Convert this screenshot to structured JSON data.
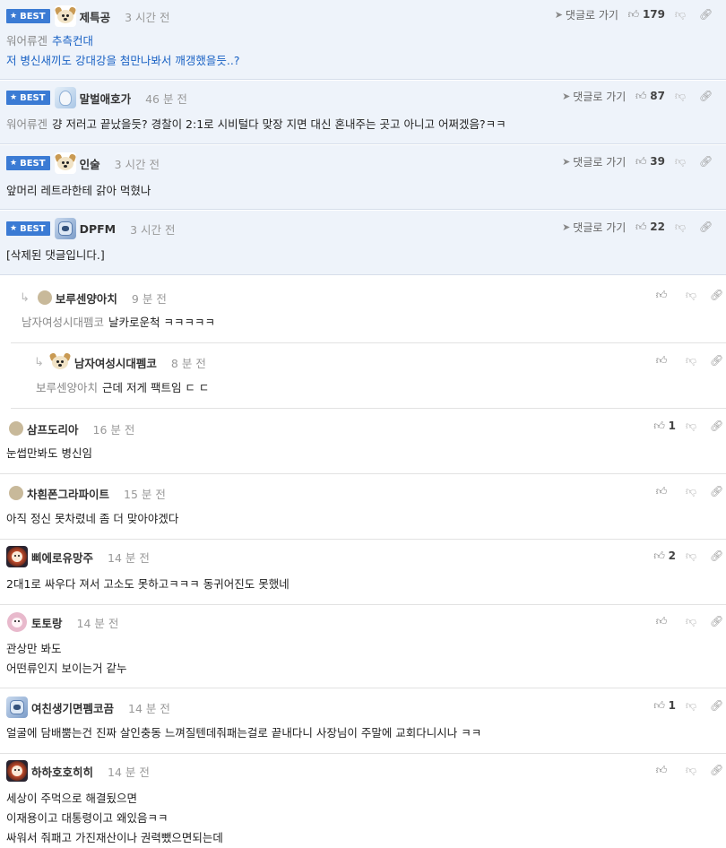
{
  "ui": {
    "best_label": "BEST",
    "reply_label": "댓글로 가기",
    "reply_arrow": "↳"
  },
  "comments": [
    {
      "best": true,
      "nick": "제특공",
      "time": "3 시간 전",
      "likes": "179",
      "avatar": "dog",
      "mention": "워어류겐",
      "lines": [
        "추측컨대",
        "저 병신새끼도 강대강을 첨만나봐서 깨갱했을듯..?"
      ],
      "link_color": true
    },
    {
      "best": true,
      "nick": "말벌애호가",
      "time": "46 분 전",
      "likes": "87",
      "avatar": "dolphin",
      "mention": "워어류겐",
      "lines": [
        "걍 저러고 끝났을듯? 경찰이 2:1로 시비털다 맞장 지면 대신 혼내주는 곳고 아니고 어쩌겠음?ㅋㅋ"
      ]
    },
    {
      "best": true,
      "nick": "인술",
      "time": "3 시간 전",
      "likes": "39",
      "avatar": "dog",
      "mention": "",
      "lines": [
        "앞머리 레트라한테 갉아 먹혔나"
      ]
    },
    {
      "best": true,
      "nick": "DPFM",
      "time": "3 시간 전",
      "likes": "22",
      "avatar": "blob",
      "mention": "",
      "lines": [
        "[삭제된 댓글입니다.]"
      ]
    },
    {
      "best": false,
      "nick": "보루센양아치",
      "time": "9 분 전",
      "likes": "",
      "avatar": "dot",
      "depth": 1,
      "mention": "남자여성시대펨코",
      "lines": [
        "날카로운척 ㅋㅋㅋㅋㅋ"
      ]
    },
    {
      "best": false,
      "nick": "남자여성시대펨코",
      "time": "8 분 전",
      "likes": "",
      "avatar": "dog",
      "depth": 2,
      "mention": "보루센양아치",
      "lines": [
        "근데 저게 팩트임 ㄷ ㄷ"
      ]
    },
    {
      "best": false,
      "nick": "삼프도리아",
      "time": "16 분 전",
      "likes": "1",
      "avatar": "dot",
      "mention": "",
      "lines": [
        "눈썹만봐도 병신임"
      ]
    },
    {
      "best": false,
      "nick": "차흰폰그라파이트",
      "time": "15 분 전",
      "likes": "",
      "avatar": "dot",
      "mention": "",
      "lines": [
        "아직 정신 못차렸네 좀 더 맞아야겠다"
      ]
    },
    {
      "best": false,
      "nick": "삐에로유망주",
      "time": "14 분 전",
      "likes": "2",
      "avatar": "lion",
      "mention": "",
      "lines": [
        "2대1로 싸우다 져서 고소도 못하고ㅋㅋㅋ 동귀어진도 못했네"
      ]
    },
    {
      "best": false,
      "nick": "토토랑",
      "time": "14 분 전",
      "likes": "",
      "avatar": "pink",
      "mention": "",
      "lines": [
        "관상만 봐도",
        "어떤류인지 보이는거 같누"
      ]
    },
    {
      "best": false,
      "nick": "여친생기면펨코끔",
      "time": "14 분 전",
      "likes": "1",
      "avatar": "blob",
      "mention": "",
      "lines": [
        "얼굴에 담배뿜는건 진짜 살인충동 느껴질텐데줘패는걸로 끝내다니 사장님이 주말에 교회다니시나 ㅋㅋ"
      ]
    },
    {
      "best": false,
      "nick": "하하호호히히",
      "time": "14 분 전",
      "likes": "",
      "avatar": "lion",
      "mention": "",
      "lines": [
        "세상이 주먹으로 해결됬으면",
        "이재용이고 대통령이고 왜있음ㅋㅋ",
        "싸워서 줘패고 가진재산이나 권력뺐으면되는데"
      ]
    }
  ]
}
